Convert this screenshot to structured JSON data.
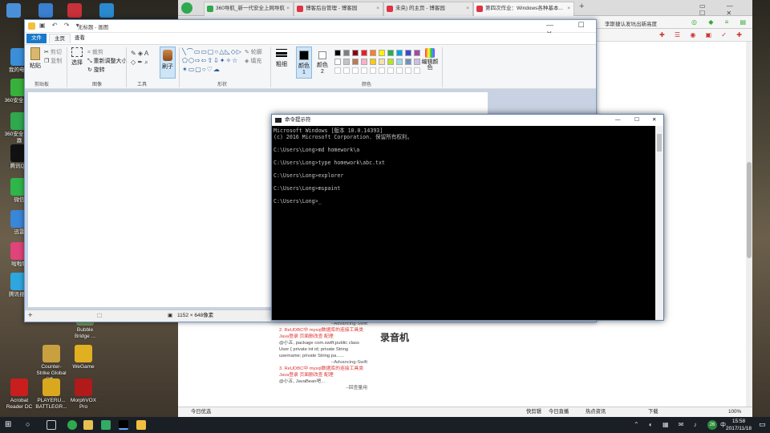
{
  "desktop": {
    "icons": [
      {
        "label": "我的电脑",
        "color": "#3a8fd8"
      },
      {
        "label": "360安全卫士",
        "color": "#38b13c"
      },
      {
        "label": "360安全浏览器",
        "color": "#2fa84e"
      },
      {
        "label": "腾讯QQ",
        "color": "#111111"
      },
      {
        "label": "微信",
        "color": "#2fb64a"
      },
      {
        "label": "迅雷",
        "color": "#3a86d8"
      },
      {
        "label": "啦啦聊",
        "color": "#e0447a"
      },
      {
        "label": "腾讯视频",
        "color": "#2ea7e0"
      },
      {
        "label": "Counter-Strike Global Off...",
        "color": "#c8a040"
      },
      {
        "label": "WeGame",
        "color": "#e0b020"
      },
      {
        "label": "Acrobat Reader DC",
        "color": "#c81e1e"
      },
      {
        "label": "PLAYERU... BATTLEGR...",
        "color": "#d9a81e"
      },
      {
        "label": "MorphVOX Pro",
        "color": "#b01a1a"
      },
      {
        "label": "Bubble Bridge ...",
        "color": "#6b8f5a"
      }
    ]
  },
  "browser": {
    "tabs": [
      {
        "label": "360导航_新一代安全上网导航"
      },
      {
        "label": "博客后台管理 - 博客园"
      },
      {
        "label": "未央) 的主页 - 博客园"
      },
      {
        "label": "第四次作业：Windows各种基本..."
      }
    ],
    "new_tab": "+",
    "search_hint": "李斯捷认发坑出新高度",
    "sidebar_items": [
      "--Advancing-Swift",
      "2. ReUDBC中 mysql数据库的连接工具类 Java登录 页面删改查 配理",
      "@小五, package com.swift;public class User { private int id; private String username; private String pa......",
      "--Advancing-Swift",
      "3. ReUDBC中 mysql数据库的连接工具类 Java登录 页面删改查 配理",
      "@小五, JavaBean吧...",
      "--回查量用"
    ],
    "heading": "录音机",
    "status": {
      "left": "今日优选",
      "items": [
        "快剪辑",
        "今日直播",
        "热点资讯",
        "下载",
        "100%"
      ]
    }
  },
  "paint": {
    "title": "无标题 - 画图",
    "tabs": [
      "文件",
      "主页",
      "查看"
    ],
    "groups": {
      "clipboard": "剪贴板",
      "image": "图像",
      "tools": "工具",
      "shapes": "形状",
      "colors": "颜色"
    },
    "buttons": {
      "paste": "粘贴",
      "cut": "剪切",
      "copy": "复制",
      "select": "选择",
      "crop": "裁剪",
      "resize": "重新调整大小",
      "rotate": "旋转",
      "brush": "刷子",
      "outline": "轮廓",
      "fill": "填充",
      "size": "粗细",
      "color1": "颜色 1",
      "color2": "颜色 2",
      "edit_colors": "编辑颜色"
    },
    "palette": [
      "#000000",
      "#7f7f7f",
      "#880015",
      "#ed1c24",
      "#ff7f27",
      "#fff200",
      "#22b14c",
      "#00a2e8",
      "#3f48cc",
      "#a349a4",
      "#ffffff",
      "#c3c3c3",
      "#b97a57",
      "#ffaec9",
      "#ffc90e",
      "#efe4b0",
      "#b5e61d",
      "#99d9ea",
      "#7092be",
      "#c8bfe7"
    ],
    "canvas_size": "1152 × 648像素"
  },
  "cmd": {
    "title": "命令提示符",
    "lines": [
      "Microsoft Windows [版本 10.0.14393]",
      "(c) 2016 Microsoft Corporation. 保留所有权利。",
      "",
      "C:\\Users\\Long>md homework\\a",
      "",
      "C:\\Users\\Long>type homework\\abc.txt",
      "",
      "C:\\Users\\Long>explorer",
      "",
      "C:\\Users\\Long>mspaint",
      "",
      "C:\\Users\\Long>_"
    ]
  },
  "taskbar": {
    "time": "15:58",
    "date": "2017/11/18",
    "badge": "26",
    "lang": "中"
  }
}
